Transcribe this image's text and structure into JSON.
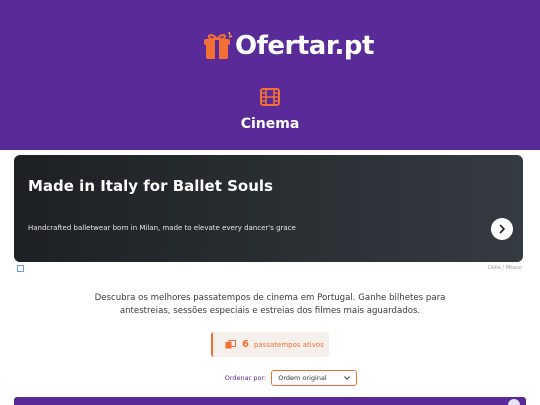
{
  "brand": {
    "name": "Ofertar.pt"
  },
  "category": {
    "title": "Cinema",
    "icon": "film-icon"
  },
  "ad": {
    "title": "Made in Italy for Ballet Souls",
    "subtitle": "Handcrafted balletwear born in Milan, made to elevate every dancer's grace",
    "brand": "Della / Milano",
    "next_icon": "chevron-right-icon"
  },
  "description": "Descubra os melhores passatempos de cinema em Portugal. Ganhe bilhetes para antestreias, sessões especiais e estreias dos filmes mais aguardados.",
  "count": {
    "value": "6",
    "label": "passatempos ativos",
    "icon": "tickets-icon"
  },
  "sort": {
    "label": "Ordenar por:",
    "selected": "Ordem original"
  },
  "colors": {
    "header": "#5a2b98",
    "accent": "#f26f35"
  }
}
